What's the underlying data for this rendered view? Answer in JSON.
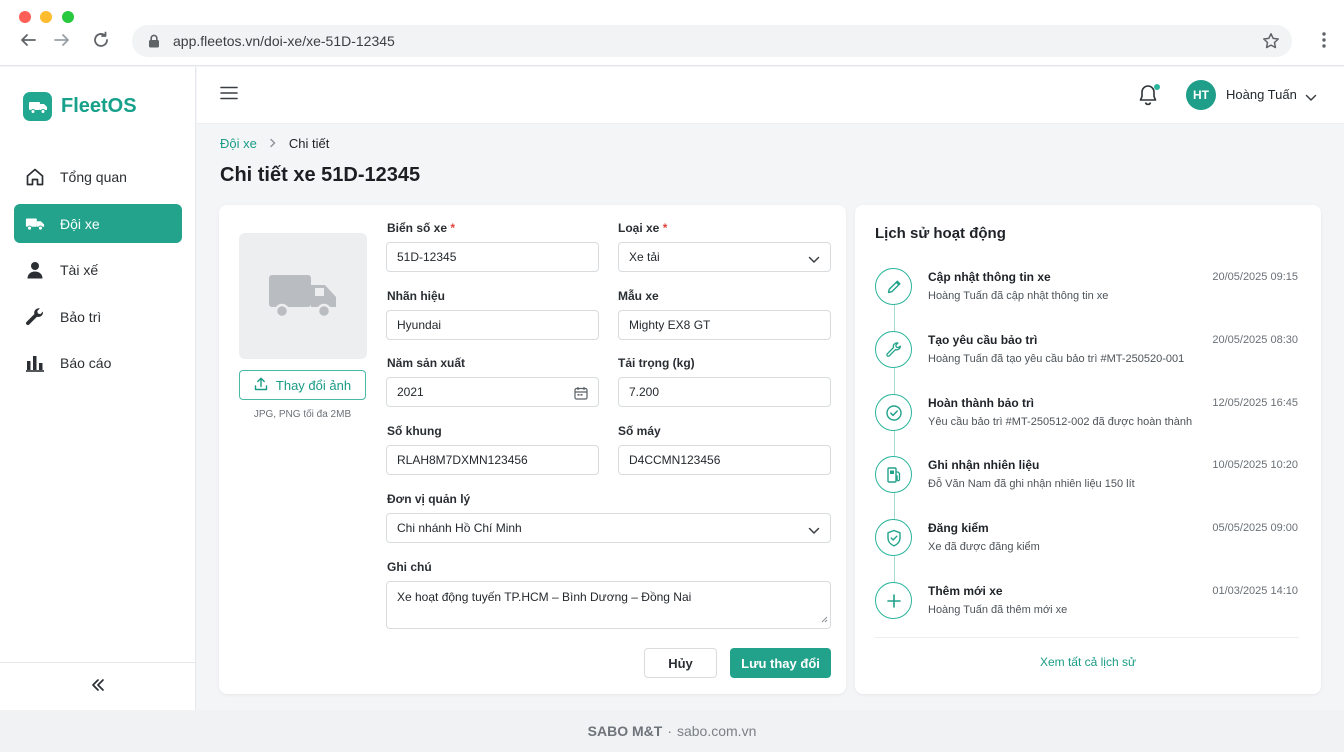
{
  "browser": {
    "url": "app.fleetos.vn/doi-xe/xe-51D-12345"
  },
  "app": {
    "name": "FleetOS"
  },
  "sidebar": {
    "items": [
      {
        "label": "Tổng quan",
        "icon": "home-icon"
      },
      {
        "label": "Đội xe",
        "icon": "truck-icon",
        "active": true
      },
      {
        "label": "Tài xế",
        "icon": "user-icon"
      },
      {
        "label": "Bảo trì",
        "icon": "wrench-icon"
      },
      {
        "label": "Báo cáo",
        "icon": "bar-chart-icon"
      }
    ],
    "collapse_icon": "double-chevron-left-icon"
  },
  "header": {
    "user_initials": "HT",
    "user_name": "Hoàng Tuấn"
  },
  "breadcrumb": {
    "parent": "Đội xe",
    "current": "Chi tiết"
  },
  "page": {
    "title": "Chi tiết xe 51D-12345"
  },
  "form": {
    "upload_label": "Thay đổi ảnh",
    "upload_hint": "JPG, PNG tối đa 2MB",
    "plate": {
      "label": "Biển số xe",
      "required_mark": "*",
      "value": "51D-12345"
    },
    "type": {
      "label": "Loại xe",
      "required_mark": "*",
      "value": "Xe tải"
    },
    "brand": {
      "label": "Nhãn hiệu",
      "value": "Hyundai"
    },
    "model": {
      "label": "Mẫu xe",
      "value": "Mighty EX8 GT"
    },
    "year": {
      "label": "Năm sản xuất",
      "value": "2021"
    },
    "load": {
      "label": "Tải trọng (kg)",
      "value": "7.200"
    },
    "chassis": {
      "label": "Số khung",
      "value": "RLAH8M7DXMN123456"
    },
    "engine": {
      "label": "Số máy",
      "value": "D4CCMN123456"
    },
    "unit": {
      "label": "Đơn vị quản lý",
      "value": "Chi nhánh Hồ Chí Minh"
    },
    "note": {
      "label": "Ghi chú",
      "value": "Xe hoạt động tuyến TP.HCM – Bình Dương – Đồng Nai"
    },
    "cancel_label": "Hủy",
    "save_label": "Lưu thay đổi"
  },
  "history": {
    "title": "Lịch sử hoạt động",
    "items": [
      {
        "title": "Cập nhật thông tin xe",
        "desc": "Hoàng Tuấn đã cập nhật thông tin xe",
        "time": "20/05/2025 09:15",
        "icon": "pencil-icon"
      },
      {
        "title": "Tạo yêu cầu bảo trì",
        "desc": "Hoàng Tuấn đã tạo yêu cầu bảo trì #MT-250520-001",
        "time": "20/05/2025 08:30",
        "icon": "wrench-icon"
      },
      {
        "title": "Hoàn thành bảo trì",
        "desc": "Yêu cầu bảo trì #MT-250512-002 đã được hoàn thành",
        "time": "12/05/2025 16:45",
        "icon": "check-circle-icon"
      },
      {
        "title": "Ghi nhận nhiên liệu",
        "desc": "Đỗ Văn Nam đã ghi nhận nhiên liệu 150 lít",
        "time": "10/05/2025 10:20",
        "icon": "fuel-icon"
      },
      {
        "title": "Đăng kiểm",
        "desc": "Xe đã được đăng kiểm",
        "time": "05/05/2025 09:00",
        "icon": "shield-check-icon"
      },
      {
        "title": "Thêm mới xe",
        "desc": "Hoàng Tuấn đã thêm mới xe",
        "time": "01/03/2025 14:10",
        "icon": "plus-icon"
      }
    ],
    "view_all_label": "Xem tất cả lịch sử"
  },
  "footer": {
    "brand": "SABO M&T",
    "separator": "·",
    "site": "sabo.com.vn"
  },
  "colors": {
    "accent": "#22a28b",
    "required": "#e0453b"
  }
}
